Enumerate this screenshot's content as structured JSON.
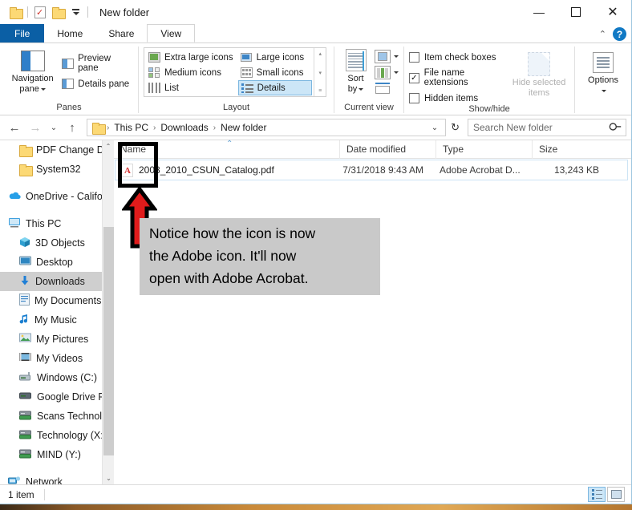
{
  "window": {
    "title": "New folder",
    "quick_access": [
      {
        "name": "folder-icon",
        "label": "Folder"
      },
      {
        "name": "properties-icon",
        "label": "Properties"
      },
      {
        "name": "new-folder-icon",
        "label": "New folder"
      },
      {
        "name": "customize-caret-icon",
        "label": "Customize Quick Access Toolbar"
      }
    ],
    "controls": {
      "minimize": "—",
      "maximize": "☐",
      "close": "✕"
    }
  },
  "tabs": [
    {
      "label": "File",
      "active": false
    },
    {
      "label": "Home",
      "active": false
    },
    {
      "label": "Share",
      "active": false
    },
    {
      "label": "View",
      "active": true
    }
  ],
  "tab_right": {
    "collapse_icon": "⌃",
    "help_label": "?"
  },
  "ribbon": {
    "panes": {
      "label": "Panes",
      "navigation_pane": "Navigation\npane",
      "navigation_pane_line1": "Navigation",
      "navigation_pane_line2": "pane",
      "items": [
        {
          "label": "Preview pane"
        },
        {
          "label": "Details pane"
        }
      ]
    },
    "layout": {
      "label": "Layout",
      "items": [
        {
          "label": "Extra large icons",
          "selected": false
        },
        {
          "label": "Large icons",
          "selected": false
        },
        {
          "label": "Medium icons",
          "selected": false
        },
        {
          "label": "Small icons",
          "selected": false
        },
        {
          "label": "List",
          "selected": false
        },
        {
          "label": "Details",
          "selected": true
        }
      ],
      "scroll_up": "▴",
      "scroll_down": "▾",
      "scroll_expand": "≡"
    },
    "current_view": {
      "label": "Current view",
      "sort_by_line1": "Sort",
      "sort_by_line2": "by",
      "group_by": "Group by",
      "add_columns": "Add columns",
      "size_columns": "Size all columns to fit"
    },
    "show_hide": {
      "label": "Show/hide",
      "checkboxes": [
        {
          "label": "Item check boxes",
          "checked": false
        },
        {
          "label": "File name extensions",
          "checked": true
        },
        {
          "label": "Hidden items",
          "checked": false
        }
      ],
      "hide_selected_line1": "Hide selected",
      "hide_selected_line2": "items"
    },
    "options": {
      "label": "Options"
    }
  },
  "addressbar": {
    "back": "←",
    "forward": "→",
    "recent": "⌄",
    "up": "↑",
    "breadcrumbs": [
      "This PC",
      "Downloads",
      "New folder"
    ],
    "separator": "›",
    "dropdown": "⌄",
    "refresh": "↻"
  },
  "search": {
    "placeholder": "Search New folder",
    "icon": "⚲"
  },
  "navpane": {
    "items": [
      {
        "label": "PDF Change Def",
        "icon": "folder-icon",
        "indent": 1,
        "selected": false
      },
      {
        "label": "System32",
        "icon": "folder-icon",
        "indent": 1,
        "selected": false
      },
      {
        "label": "",
        "icon": "spacer",
        "indent": 0,
        "selected": false
      },
      {
        "label": "OneDrive - Califor",
        "icon": "onedrive-icon",
        "indent": 0,
        "selected": false
      },
      {
        "label": "",
        "icon": "spacer",
        "indent": 0,
        "selected": false
      },
      {
        "label": "This PC",
        "icon": "this-pc-icon",
        "indent": 0,
        "selected": false
      },
      {
        "label": "3D Objects",
        "icon": "3d-objects-icon",
        "indent": 1,
        "selected": false
      },
      {
        "label": "Desktop",
        "icon": "desktop-icon",
        "indent": 1,
        "selected": false
      },
      {
        "label": "Downloads",
        "icon": "downloads-icon",
        "indent": 1,
        "selected": true
      },
      {
        "label": "My Documents",
        "icon": "documents-icon",
        "indent": 1,
        "selected": false
      },
      {
        "label": "My Music",
        "icon": "music-icon",
        "indent": 1,
        "selected": false
      },
      {
        "label": "My Pictures",
        "icon": "pictures-icon",
        "indent": 1,
        "selected": false
      },
      {
        "label": "My Videos",
        "icon": "videos-icon",
        "indent": 1,
        "selected": false
      },
      {
        "label": "Windows (C:)",
        "icon": "drive-windows-icon",
        "indent": 1,
        "selected": false
      },
      {
        "label": "Google Drive File",
        "icon": "drive-icon",
        "indent": 1,
        "selected": false
      },
      {
        "label": "Scans Technolog",
        "icon": "network-drive-icon",
        "indent": 1,
        "selected": false
      },
      {
        "label": "Technology (X:)",
        "icon": "network-drive-icon",
        "indent": 1,
        "selected": false
      },
      {
        "label": "MIND (Y:)",
        "icon": "network-drive-icon",
        "indent": 1,
        "selected": false
      },
      {
        "label": "",
        "icon": "spacer",
        "indent": 0,
        "selected": false
      },
      {
        "label": "Network",
        "icon": "network-icon",
        "indent": 0,
        "selected": false
      }
    ],
    "scroll_up": "⌃",
    "scroll_down": "⌄"
  },
  "filelist": {
    "columns": [
      {
        "label": "Name"
      },
      {
        "label": "Date modified"
      },
      {
        "label": "Type"
      },
      {
        "label": "Size"
      }
    ],
    "sort_indicator": "⌃",
    "rows": [
      {
        "name": "2008_2010_CSUN_Catalog.pdf",
        "date_modified": "7/31/2018 9:43 AM",
        "type": "Adobe Acrobat D...",
        "size": "13,243 KB",
        "icon": "pdf-icon"
      }
    ]
  },
  "annotations": {
    "callout_text": "Notice how the icon is now the Adobe icon. It'll now open with Adobe Acrobat.",
    "callout_lines": [
      "Notice how the icon is now",
      "the Adobe icon. It'll now",
      "open with Adobe Acrobat."
    ],
    "highlight_color": "#000000",
    "arrow_color": "#e01b1b",
    "callout_bg": "#c9c9c9"
  },
  "statusbar": {
    "item_count": "1 item",
    "view_details_icon": "details-view-icon",
    "view_thumbnails_icon": "thumbnail-view-icon"
  }
}
